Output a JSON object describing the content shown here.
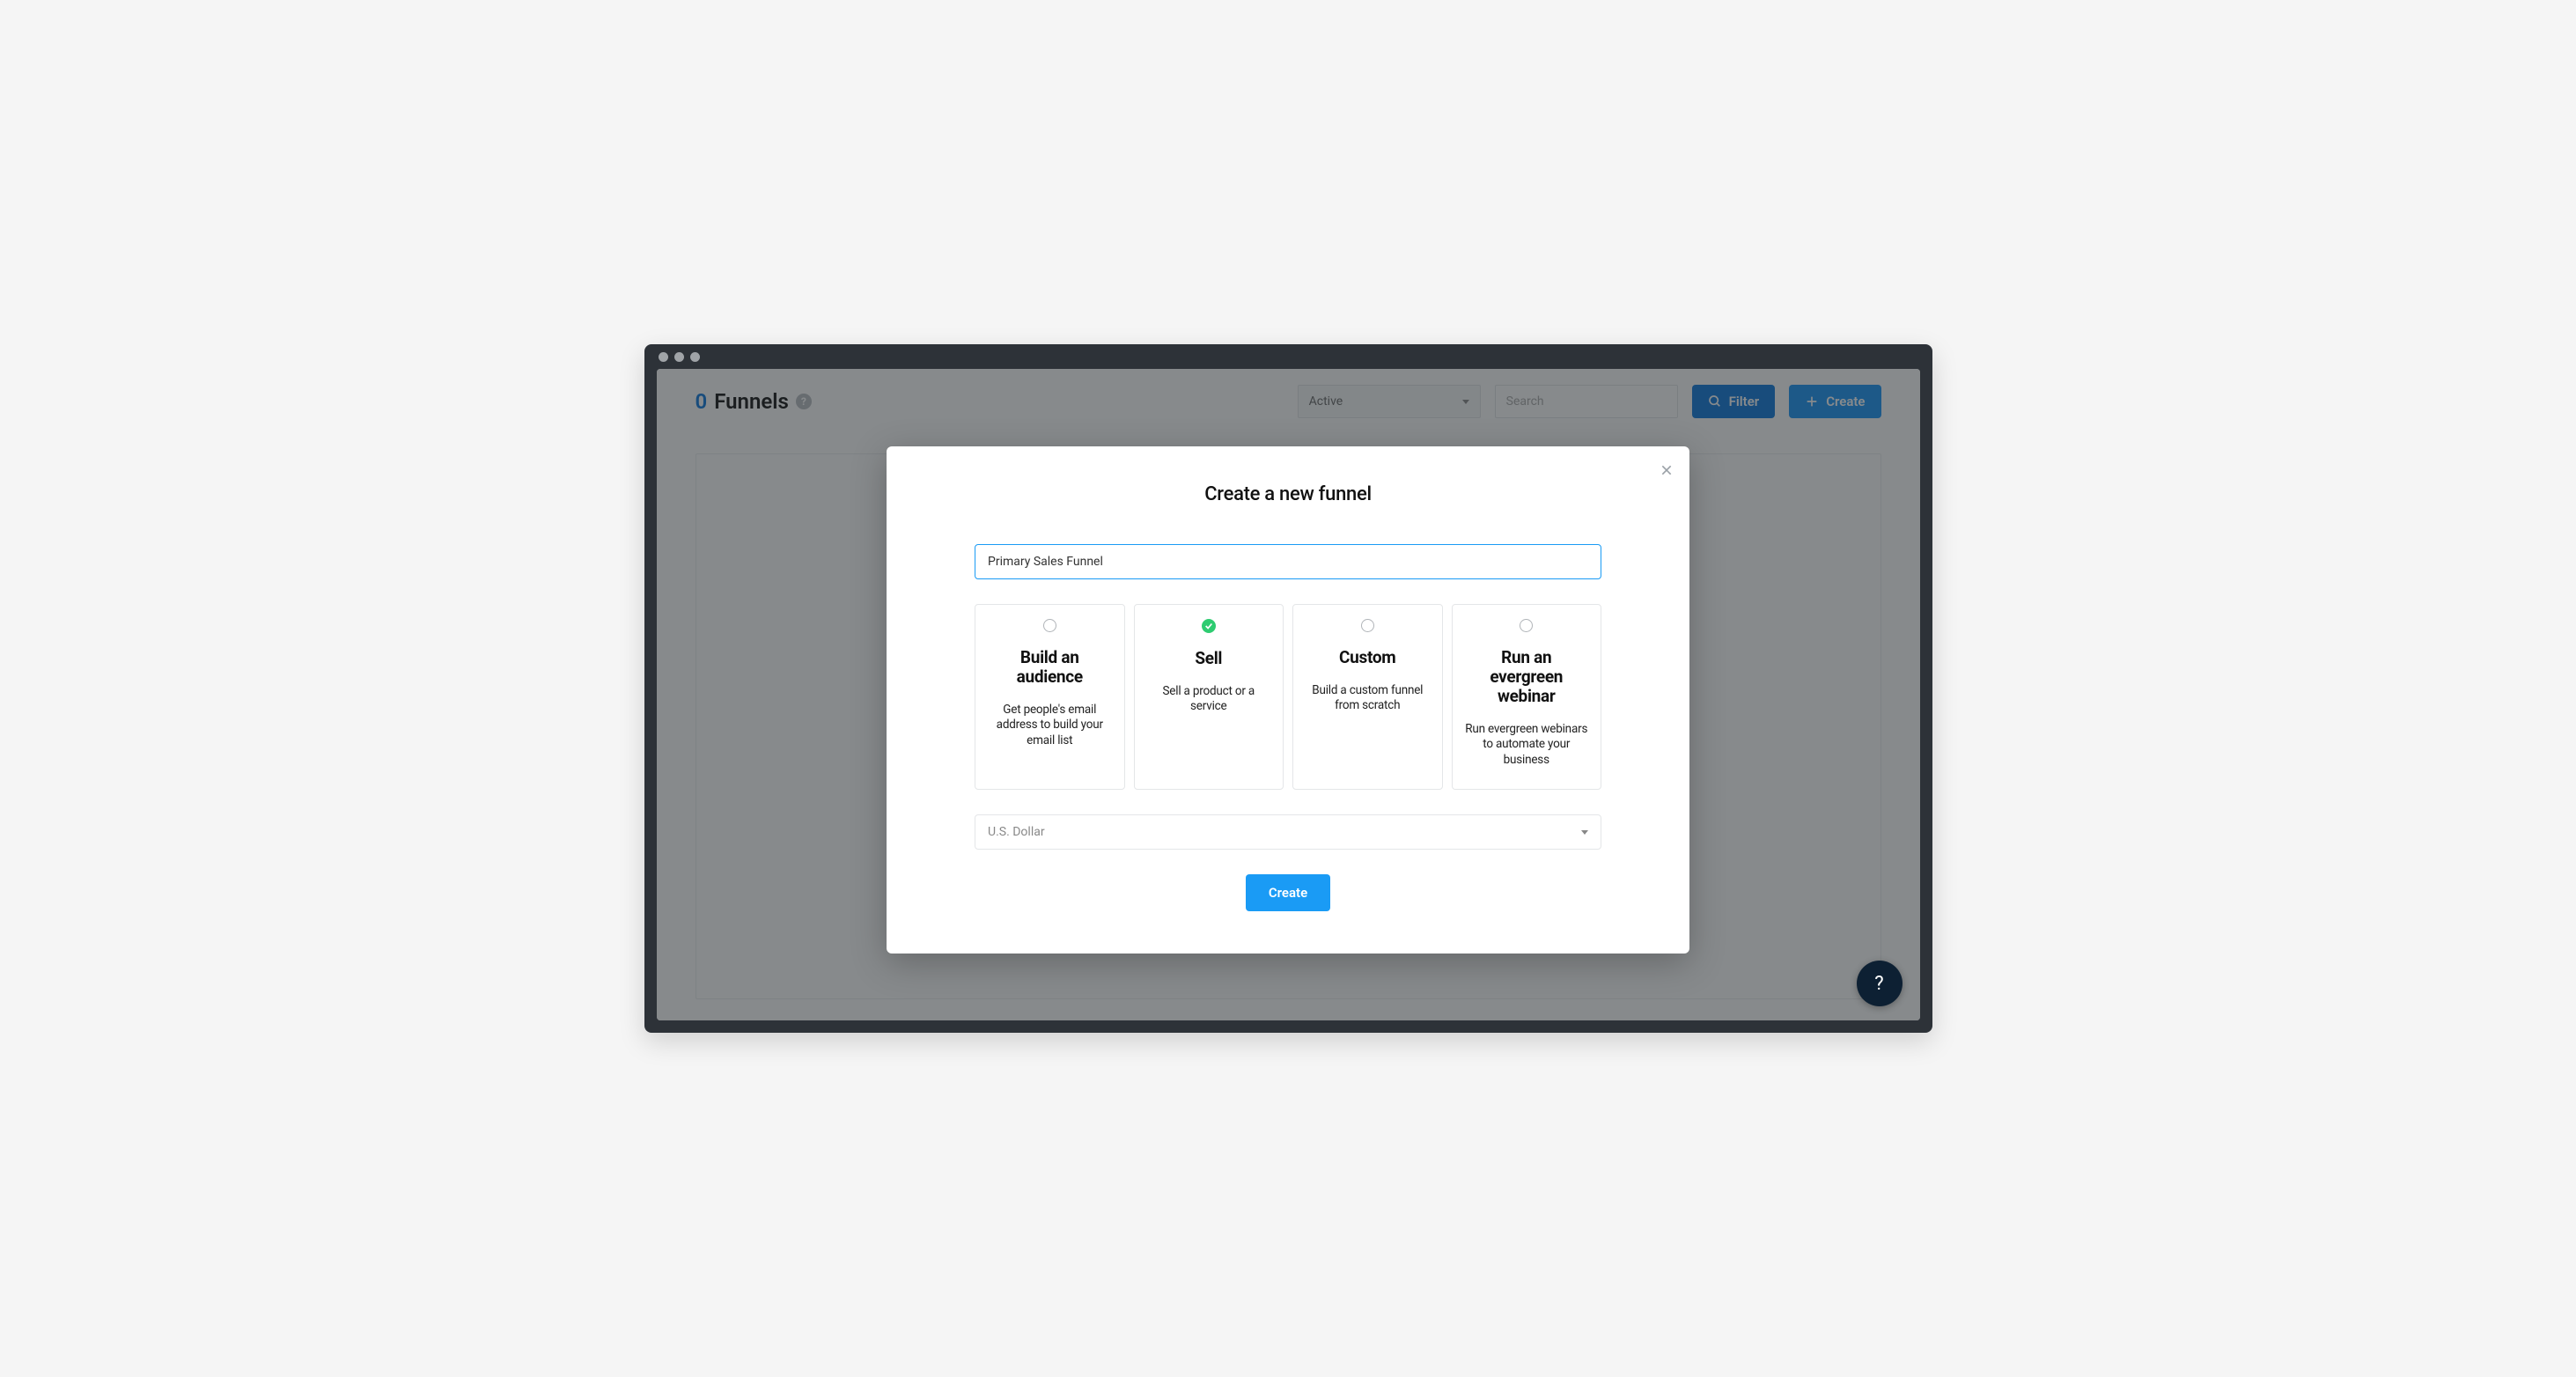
{
  "header": {
    "count": "0",
    "title": "Funnels",
    "status_filter": "Active",
    "search_placeholder": "Search",
    "filter_label": "Filter",
    "create_label": "Create"
  },
  "modal": {
    "title": "Create a new funnel",
    "name_value": "Primary Sales Funnel",
    "currency_value": "U.S. Dollar",
    "submit_label": "Create",
    "options": [
      {
        "id": "audience",
        "title": "Build an audience",
        "desc": "Get people's email address to build your email list",
        "selected": false
      },
      {
        "id": "sell",
        "title": "Sell",
        "desc": "Sell a product or a service",
        "selected": true
      },
      {
        "id": "custom",
        "title": "Custom",
        "desc": "Build a custom funnel from scratch",
        "selected": false
      },
      {
        "id": "webinar",
        "title": "Run an evergreen webinar",
        "desc": "Run evergreen webinars to automate your business",
        "selected": false
      }
    ]
  },
  "fab_label": "?"
}
